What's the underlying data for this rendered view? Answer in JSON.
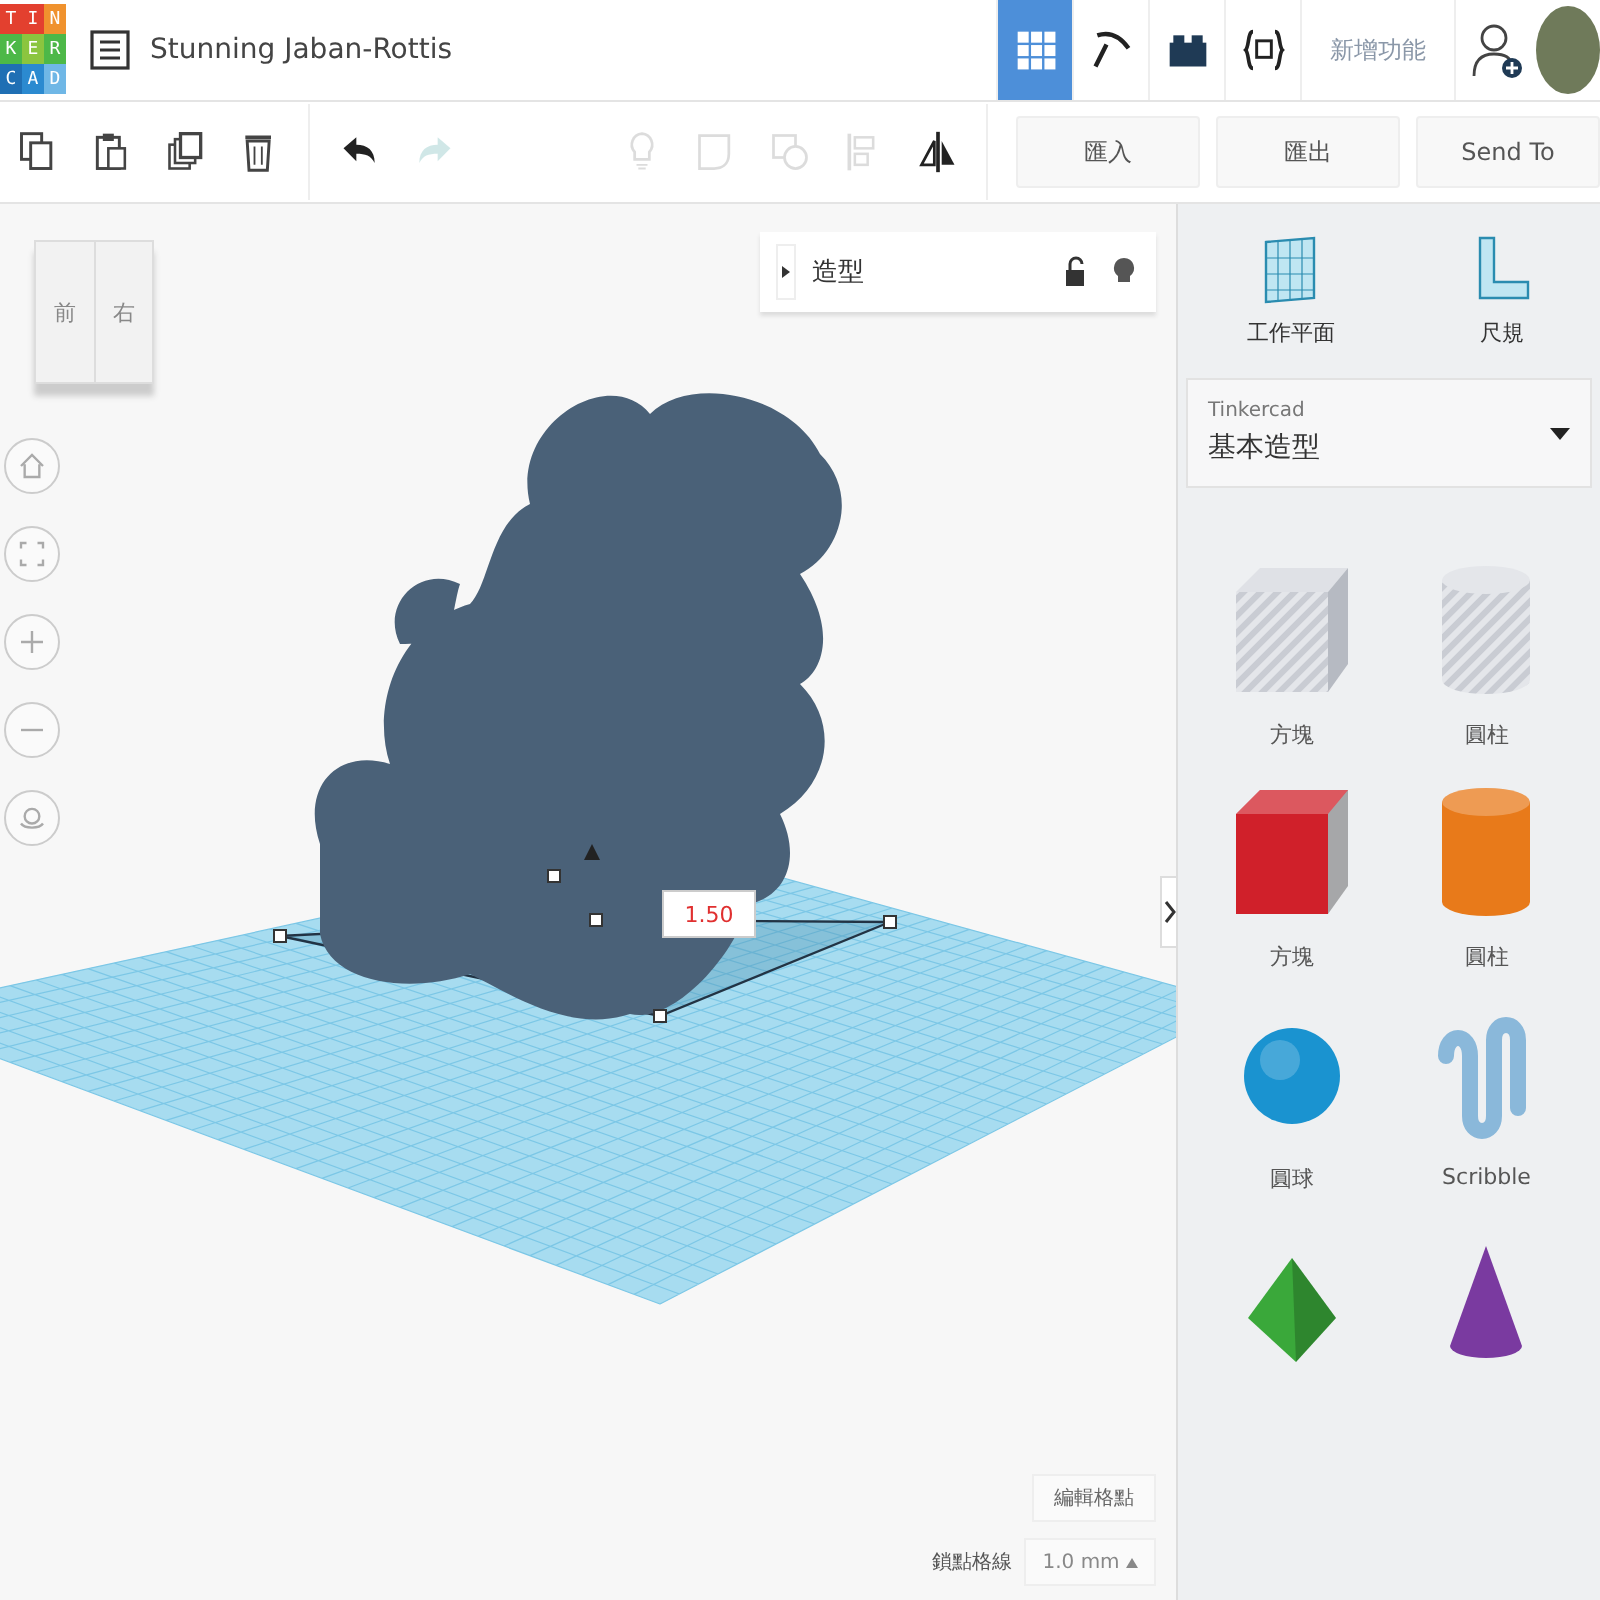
{
  "header": {
    "logo_letters": [
      "T",
      "I",
      "N",
      "K",
      "E",
      "R",
      "C",
      "A",
      "D"
    ],
    "title": "Stunning Jaban-Rottis",
    "modes": [
      {
        "kind": "grid",
        "selected": true
      },
      {
        "kind": "pickaxe",
        "selected": false
      },
      {
        "kind": "bricks",
        "selected": false
      },
      {
        "kind": "codeblocks",
        "selected": false
      }
    ],
    "whats_new": "新增功能"
  },
  "toolbar": {
    "edit_tools": [
      {
        "kind": "copy",
        "disabled": false
      },
      {
        "kind": "paste",
        "disabled": false
      },
      {
        "kind": "duplicate",
        "disabled": false
      },
      {
        "kind": "delete",
        "disabled": false
      },
      {
        "kind": "undo",
        "disabled": false
      },
      {
        "kind": "redo",
        "disabled": true
      }
    ],
    "shape_tools": [
      {
        "kind": "bulb",
        "disabled": true
      },
      {
        "kind": "note",
        "disabled": true
      },
      {
        "kind": "group",
        "disabled": true
      },
      {
        "kind": "align",
        "disabled": true
      },
      {
        "kind": "mirror",
        "disabled": false
      }
    ],
    "buttons": [
      "匯入",
      "匯出",
      "Send To"
    ]
  },
  "view_cube": {
    "front": "前",
    "right": "右"
  },
  "view_controls": [
    {
      "kind": "home"
    },
    {
      "kind": "fit"
    },
    {
      "kind": "zoom-in"
    },
    {
      "kind": "zoom-out"
    },
    {
      "kind": "orbit"
    }
  ],
  "inspector": {
    "title": "造型"
  },
  "dimension_label": "1.50",
  "grid_controls": {
    "edit_grid": "編輯格點",
    "snap_label": "鎖點格線",
    "snap_value": "1.0 mm"
  },
  "panel": {
    "tools": [
      {
        "kind": "workplane",
        "label": "工作平面"
      },
      {
        "kind": "ruler",
        "label": "尺規"
      }
    ],
    "library": {
      "source": "Tinkercad",
      "name": "基本造型"
    },
    "shapes": [
      {
        "kind": "box-hole",
        "label": "方塊"
      },
      {
        "kind": "cylinder-hole",
        "label": "圓柱"
      },
      {
        "kind": "box",
        "label": "方塊",
        "color": "#d0202a"
      },
      {
        "kind": "cylinder",
        "label": "圓柱",
        "color": "#e87a1a"
      },
      {
        "kind": "sphere",
        "label": "圓球",
        "color": "#1a93d0"
      },
      {
        "kind": "scribble",
        "label": "Scribble",
        "color": "#8ab8da"
      },
      {
        "kind": "pyramid",
        "color": "#3aa83a"
      },
      {
        "kind": "cone",
        "color": "#7a3aa0"
      }
    ]
  }
}
